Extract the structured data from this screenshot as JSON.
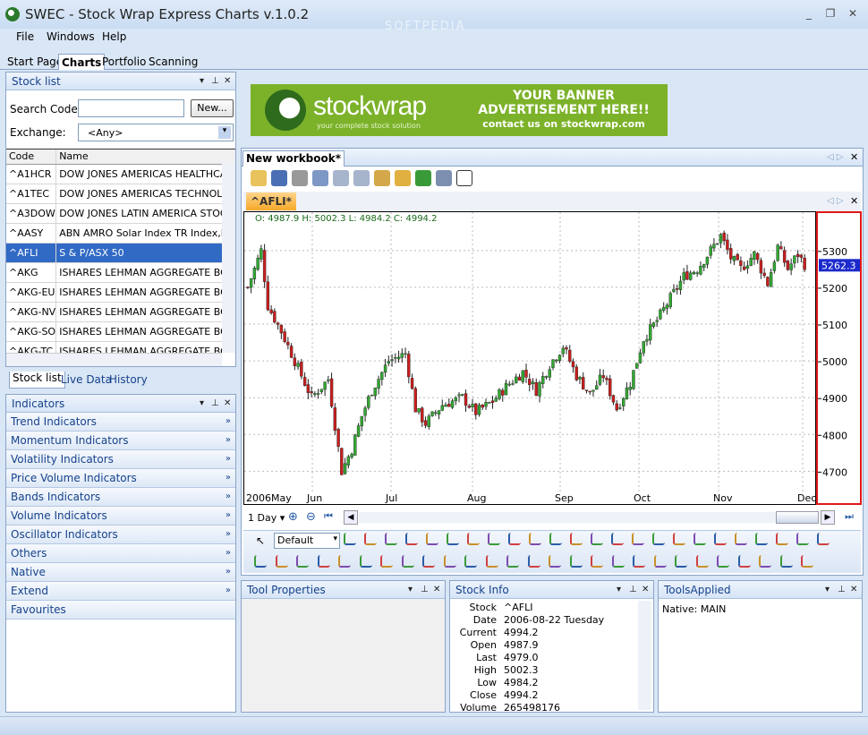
{
  "window": {
    "title": "SWEC - Stock Wrap Express Charts v.1.0.2",
    "minimize": "_",
    "restore": "❐",
    "close": "✕"
  },
  "watermark": "SOFTPEDIA",
  "menu": [
    "File",
    "Windows",
    "Help"
  ],
  "app_tabs": [
    "Start Page",
    "Charts",
    "Portfolio",
    "Scanning"
  ],
  "stock_list": {
    "title": "Stock list",
    "search_label": "Search Code:",
    "search_value": "",
    "new_button": "New...",
    "exchange_label": "Exchange:",
    "exchange_value": "<Any>",
    "columns": [
      "Code",
      "Name"
    ],
    "rows": [
      [
        "^A1HCR",
        "DOW JONES AMERICAS HEALTHCARE"
      ],
      [
        "^A1TEC",
        "DOW JONES AMERICAS TECHNOLOGY"
      ],
      [
        "^A3DOW",
        "DOW JONES LATIN AMERICA STOCK"
      ],
      [
        "^AASY",
        "ABN AMRO Solar Index TR Index,R"
      ],
      [
        "^AFLI",
        "S & P/ASX 50"
      ],
      [
        "^AKG",
        "ISHARES LEHMAN AGGREGATE BOND"
      ],
      [
        "^AKG-EU",
        "ISHARES LEHMAN AGGREGATE BOND"
      ],
      [
        "^AKG-NV",
        "ISHARES LEHMAN AGGREGATE BOND"
      ],
      [
        "^AKG-SO",
        "ISHARES LEHMAN AGGREGATE BOND"
      ],
      [
        "^AKG-TC",
        "ISHARES LEHMAN AGGREGATE BOND"
      ]
    ],
    "selected_index": 4,
    "bottom_tabs": [
      "Stock list",
      "Live Data",
      "History"
    ]
  },
  "indicators": {
    "title": "Indicators",
    "groups": [
      "Trend Indicators",
      "Momentum Indicators",
      "Volatility Indicators",
      "Price Volume Indicators",
      "Bands Indicators",
      "Volume Indicators",
      "Oscillator Indicators",
      "Others",
      "Native",
      "Extend",
      "Favourites"
    ]
  },
  "banner": {
    "brand": "stockwrap",
    "tagline": "your complete stock solution",
    "line1": "YOUR BANNER",
    "line2": "ADVERTISEMENT HERE!!",
    "line3": "contact us on stockwrap.com"
  },
  "workbook": {
    "tab": "New workbook*",
    "chart_tab": "^AFLI*",
    "ohlc": "O: 4987.9 H: 5002.3 L: 4984.2 C: 4994.2",
    "current_price": "5262.3",
    "period": "1 Day",
    "drawing_style": "Default"
  },
  "chart_data": {
    "type": "candlestick",
    "x_labels": [
      "2006May",
      "Jun",
      "Jul",
      "Aug",
      "Sep",
      "Oct",
      "Nov",
      "Dec"
    ],
    "y_ticks": [
      4700,
      4800,
      4900,
      5000,
      5100,
      5200,
      5300
    ],
    "ylim": [
      4645,
      5375
    ],
    "last_price": 5262.3,
    "grid": true,
    "colors": {
      "up": "#33a833",
      "down": "#c81e1e"
    },
    "anchors": [
      [
        0,
        5200
      ],
      [
        4,
        5300
      ],
      [
        6,
        5150
      ],
      [
        10,
        5080
      ],
      [
        14,
        5000
      ],
      [
        19,
        4900
      ],
      [
        24,
        4950
      ],
      [
        28,
        4700
      ],
      [
        31,
        4760
      ],
      [
        34,
        4850
      ],
      [
        37,
        4920
      ],
      [
        42,
        5000
      ],
      [
        47,
        5020
      ],
      [
        50,
        4870
      ],
      [
        53,
        4830
      ],
      [
        58,
        4880
      ],
      [
        64,
        4900
      ],
      [
        68,
        4860
      ],
      [
        73,
        4890
      ],
      [
        77,
        4930
      ],
      [
        82,
        4970
      ],
      [
        86,
        4920
      ],
      [
        90,
        4990
      ],
      [
        94,
        5040
      ],
      [
        98,
        4960
      ],
      [
        102,
        4910
      ],
      [
        106,
        4960
      ],
      [
        110,
        4870
      ],
      [
        114,
        4940
      ],
      [
        118,
        5060
      ],
      [
        122,
        5110
      ],
      [
        126,
        5170
      ],
      [
        130,
        5230
      ],
      [
        134,
        5250
      ],
      [
        138,
        5300
      ],
      [
        141,
        5340
      ],
      [
        144,
        5280
      ],
      [
        147,
        5250
      ],
      [
        151,
        5290
      ],
      [
        155,
        5210
      ],
      [
        158,
        5310
      ],
      [
        161,
        5250
      ],
      [
        164,
        5290
      ],
      [
        166,
        5262
      ]
    ]
  },
  "tool_properties": {
    "title": "Tool Properties"
  },
  "stock_info": {
    "title": "Stock Info",
    "rows": [
      [
        "Stock",
        "^AFLI"
      ],
      [
        "Date",
        "2006-08-22 Tuesday"
      ],
      [
        "Current",
        "4994.2"
      ],
      [
        "Open",
        "4987.9"
      ],
      [
        "Last",
        "4979.0"
      ],
      [
        "High",
        "5002.3"
      ],
      [
        "Low",
        "4984.2"
      ],
      [
        "Close",
        "4994.2"
      ],
      [
        "Volume",
        "265498176"
      ]
    ]
  },
  "tools_applied": {
    "title": "ToolsApplied",
    "items": [
      "Native: MAIN"
    ]
  },
  "icons": {
    "pin": "📌",
    "close": "✕",
    "dropdown": "▾",
    "chevron": "»"
  }
}
